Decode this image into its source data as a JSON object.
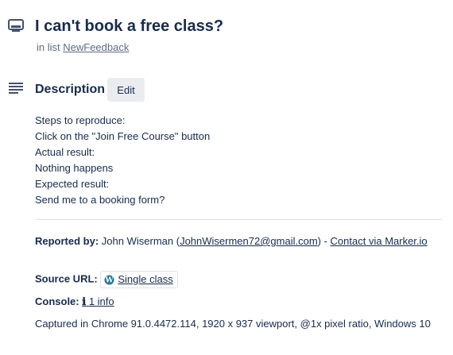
{
  "card": {
    "title": "I can't book a free class?",
    "list_prefix": "in list",
    "list_name": "NewFeedback"
  },
  "description": {
    "heading": "Description",
    "edit_label": "Edit",
    "lines": [
      "Steps to reproduce:",
      "Click on the \"Join Free Course\" button",
      "Actual result:",
      "Nothing happens",
      "Expected result:",
      "Send me to a booking form?"
    ]
  },
  "meta": {
    "reported_label": "Reported by:",
    "reporter_name": "John Wiserman",
    "reporter_email": "JohnWisermen72@gmail.com",
    "contact_link": "Contact via Marker.io",
    "source_label": "Source URL:",
    "source_link": "Single class",
    "console_label": "Console:",
    "console_glyph": "ℹ",
    "console_link": "1 info",
    "captured": "Captured in Chrome 91.0.4472.114, 1920 x 937 viewport, @1x pixel ratio, Windows 10"
  },
  "icons": {
    "card": "card-icon",
    "description": "description-lines-icon",
    "source": "wordpress-icon",
    "console": "info-icon"
  },
  "colors": {
    "text": "#172b4d",
    "muted": "#5e6c84",
    "link": "#0052cc",
    "button_bg": "#ebecf0",
    "divider": "#dfe1e6"
  }
}
